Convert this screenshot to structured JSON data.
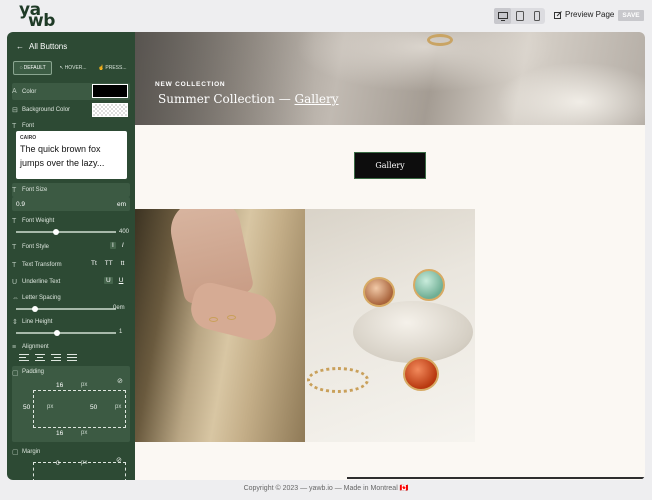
{
  "logo": {
    "line1": "ya",
    "line2": "wb"
  },
  "topbar": {
    "devices": [
      "desktop-icon",
      "tablet-icon",
      "mobile-icon"
    ],
    "preview_label": "Preview Page",
    "save_label": "SAVE"
  },
  "sidebar": {
    "title": "All Buttons",
    "states": [
      {
        "label": "DEFAULT",
        "icon": "circle-icon"
      },
      {
        "label": "HOVER...",
        "icon": "cursor-icon"
      },
      {
        "label": "PRESS...",
        "icon": "press-icon"
      }
    ],
    "color_label": "Color",
    "bg_color_label": "Background Color",
    "font_label": "Font",
    "font_name": "CAIRO",
    "font_sample": "The quick brown fox jumps over the lazy...",
    "font_size_label": "Font Size",
    "font_size_value": "0.9",
    "font_size_unit": "em",
    "font_weight_label": "Font Weight",
    "font_weight_value": "400",
    "font_weight_level": 0.4,
    "font_style_label": "Font Style",
    "font_style_opts": [
      "I",
      "I"
    ],
    "text_transform_label": "Text Transform",
    "text_transform_opts": [
      "Tt",
      "TT",
      "tt"
    ],
    "underline_label": "Underline Text",
    "underline_opts": [
      "U",
      "U"
    ],
    "letter_spacing_label": "Letter Spacing",
    "letter_spacing_value": "0em",
    "line_height_label": "Line Height",
    "line_height_value": "1",
    "alignment_label": "Alignment",
    "padding_label": "Padding",
    "padding": {
      "top": "16",
      "left": "50",
      "right": "50",
      "bottom": "16",
      "unit": "px"
    },
    "margin_label": "Margin",
    "margin_top": "0",
    "margin_unit": "px"
  },
  "canvas": {
    "hero_subtitle": "NEW COLLECTION",
    "hero_title": "Summer Collection — ",
    "hero_link": "Gallery",
    "button_label": "Gallery"
  },
  "footer": "Copyright © 2023 — yawb.io — Made in Montreal 🇨🇦"
}
